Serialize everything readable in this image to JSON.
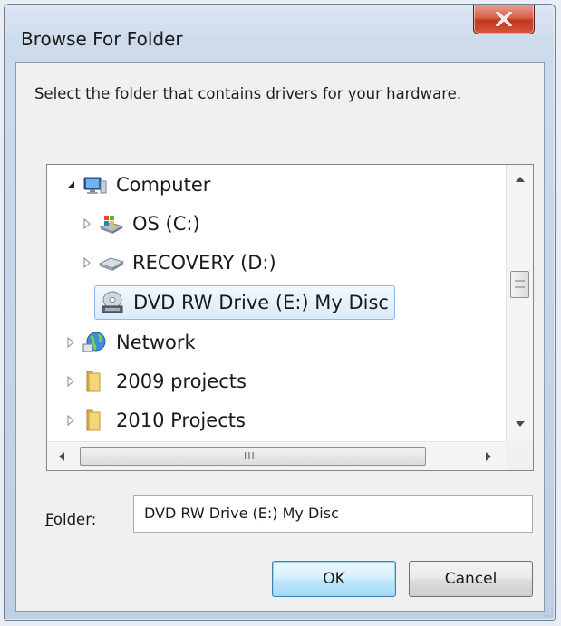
{
  "window": {
    "title": "Browse For Folder",
    "close_symbol": "X"
  },
  "instruction": "Select the folder that contains drivers for your hardware.",
  "tree": {
    "items": [
      {
        "label": "Computer",
        "icon": "computer-icon",
        "expander": "expanded"
      },
      {
        "label": "OS (C:)",
        "icon": "windows-drive-icon",
        "expander": "collapsed"
      },
      {
        "label": "RECOVERY (D:)",
        "icon": "hard-drive-icon",
        "expander": "collapsed"
      },
      {
        "label": "DVD RW Drive (E:) My Disc",
        "icon": "dvd-drive-icon",
        "expander": "none",
        "selected": true
      },
      {
        "label": "Network",
        "icon": "network-icon",
        "expander": "collapsed"
      },
      {
        "label": "2009 projects",
        "icon": "folder-icon",
        "expander": "collapsed"
      },
      {
        "label": "2010 Projects",
        "icon": "folder-icon",
        "expander": "collapsed"
      }
    ],
    "hscroll_grip": "III"
  },
  "folder": {
    "label_accel": "F",
    "label_rest": "older:",
    "value": "DVD RW Drive (E:) My Disc"
  },
  "buttons": {
    "ok": "OK",
    "cancel": "Cancel"
  },
  "colors": {
    "selection_border": "#8fb8e3",
    "close_button_red": "#c3361e",
    "ok_button_border": "#3c7fb1"
  }
}
